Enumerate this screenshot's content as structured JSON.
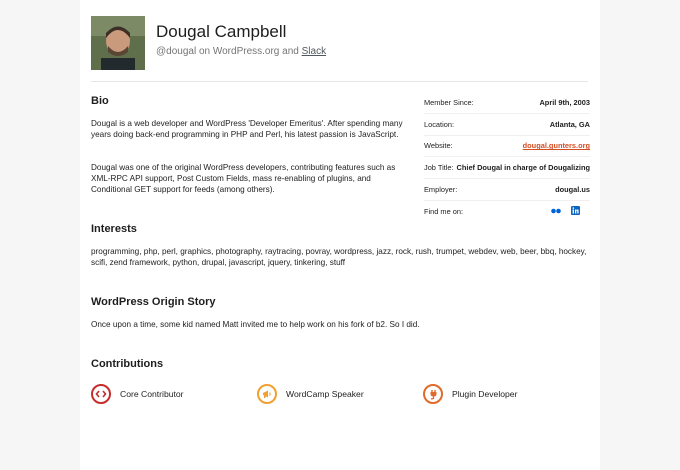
{
  "profile": {
    "name": "Dougal Campbell",
    "handle_prefix": "@dougal on WordPress.org and ",
    "slack_link": "Slack"
  },
  "bio": {
    "heading": "Bio",
    "paragraph1": "Dougal is a web developer and WordPress 'Developer Emeritus'. After spending many years doing back-end programming in PHP and Perl, his latest passion is JavaScript.",
    "paragraph2": "Dougal was one of the original WordPress developers, contributing features such as XML-RPC API support, Post Custom Fields, mass re-enabling of plugins, and Conditional GET support for feeds (among others)."
  },
  "meta": {
    "member_since_label": "Member Since:",
    "member_since_value": "April 9th, 2003",
    "location_label": "Location:",
    "location_value": "Atlanta, GA",
    "website_label": "Website:",
    "website_value": "dougal.gunters.org",
    "job_title_label": "Job Title:",
    "job_title_value": "Chief Dougal in charge of Dougalizing",
    "employer_label": "Employer:",
    "employer_value": "dougal.us",
    "find_me_label": "Find me on:",
    "icons": [
      "flickr-icon",
      "linkedin-icon"
    ]
  },
  "interests": {
    "heading": "Interests",
    "text": "programming, php, perl, graphics, photography, raytracing, povray, wordpress, jazz, rock, rush, trumpet, webdev, web, beer, bbq, hockey, scifi, zend framework, python, drupal, javascript, jquery, tinkering, stuff"
  },
  "origin": {
    "heading": "WordPress Origin Story",
    "text": "Once upon a time, some kid named Matt invited me to help work on his fork of b2. So I did."
  },
  "contributions": {
    "heading": "Contributions",
    "items": [
      {
        "label": "Core Contributor",
        "color": "#c62d2d"
      },
      {
        "label": "WordCamp Speaker",
        "color": "#f0a030"
      },
      {
        "label": "Plugin Developer",
        "color": "#e06a2a"
      }
    ]
  },
  "colors": {
    "link": "#d54e21",
    "flickr_blue": "#0063dc",
    "flickr_pink": "#ff0084",
    "linkedin": "#0a66c2"
  }
}
